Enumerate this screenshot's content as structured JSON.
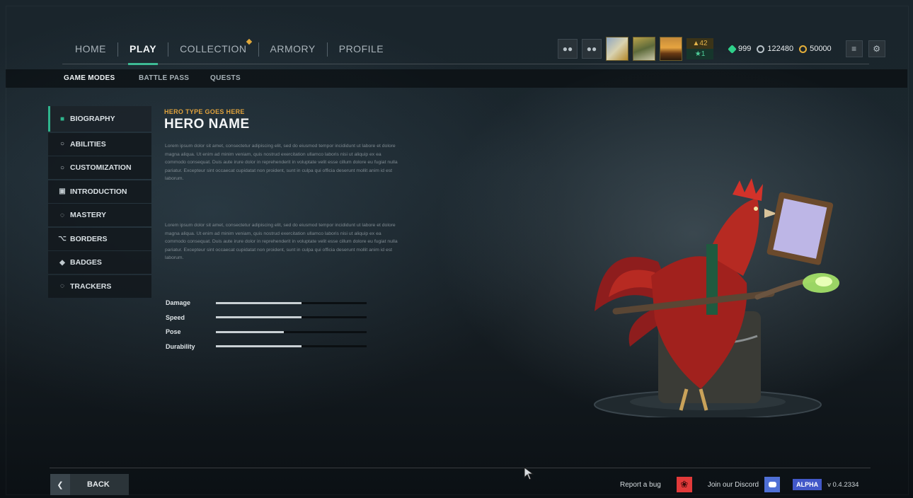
{
  "colors": {
    "accent": "#2fb58d",
    "hero_type": "#e0a23c",
    "bug": "#e23a3a",
    "discord": "#4f70d6",
    "alpha": "#4258c8"
  },
  "topnav": {
    "tabs": [
      {
        "label": "HOME"
      },
      {
        "label": "PLAY",
        "active": true
      },
      {
        "label": "COLLECTION"
      },
      {
        "label": "ARMORY"
      },
      {
        "label": "PROFILE"
      }
    ]
  },
  "topright": {
    "level_badge": "42",
    "rank_badge": "1",
    "gems": "999",
    "silver": "122480",
    "gold": "50000"
  },
  "subnav": {
    "items": [
      {
        "label": "GAME MODES",
        "active": true
      },
      {
        "label": "BATTLE PASS"
      },
      {
        "label": "QUESTS"
      }
    ]
  },
  "sidebar": {
    "items": [
      {
        "label": "BIOGRAPHY",
        "icon": "person-icon"
      },
      {
        "label": "ABILITIES",
        "icon": "cog-icon"
      },
      {
        "label": "CUSTOMIZATION",
        "icon": "cog-icon"
      },
      {
        "label": "INTRODUCTION",
        "icon": "play-icon"
      },
      {
        "label": "MASTERY",
        "icon": "ring-icon"
      },
      {
        "label": "BORDERS",
        "icon": "wings-icon"
      },
      {
        "label": "BADGES",
        "icon": "badge-icon"
      },
      {
        "label": "TRACKERS",
        "icon": "ring-icon"
      }
    ]
  },
  "hero": {
    "type": "HERO TYPE GOES HERE",
    "name": "HERO NAME",
    "paragraph1": "Lorem ipsum dolor sit amet, consectetur adipiscing elit, sed do eiusmod tempor incididunt ut labore et dolore magna aliqua. Ut enim ad minim veniam, quis nostrud exercitation ullamco laboris nisi ut aliquip ex ea commodo consequat. Duis aute irure dolor in reprehenderit in voluptate velit esse cillum dolore eu fugiat nulla pariatur. Excepteur sint occaecat cupidatat non proident, sunt in culpa qui officia deserunt mollit anim id est laborum.",
    "paragraph2": "Lorem ipsum dolor sit amet, consectetur adipiscing elit, sed do eiusmod tempor incididunt ut labore et dolore magna aliqua. Ut enim ad minim veniam, quis nostrud exercitation ullamco laboris nisi ut aliquip ex ea commodo consequat. Duis aute irure dolor in reprehenderit in voluptate velit esse cillum dolore eu fugiat nulla pariatur. Excepteur sint occaecat cupidatat non proident, sunt in culpa qui officia deserunt mollit anim id est laborum."
  },
  "stats": [
    {
      "label": "Damage",
      "value": 0.57
    },
    {
      "label": "Speed",
      "value": 0.57
    },
    {
      "label": "Pose",
      "value": 0.45
    },
    {
      "label": "Durability",
      "value": 0.57
    }
  ],
  "bottom": {
    "back_label": "BACK",
    "report_label": "Report a bug",
    "discord_label": "Join our Discord",
    "alpha_label": "ALPHA",
    "version": "v 0.4.2334"
  }
}
